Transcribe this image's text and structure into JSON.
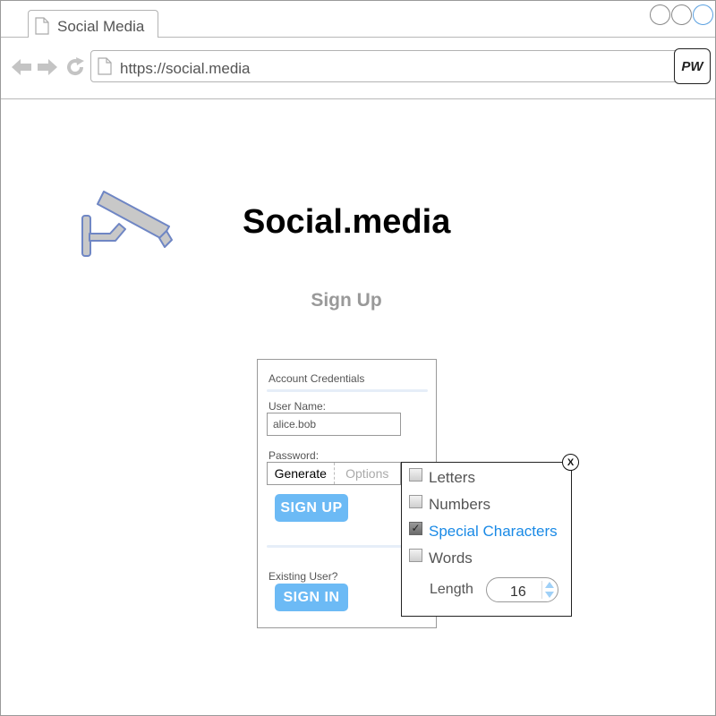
{
  "browser": {
    "tab_title": "Social Media",
    "url": "https://social.media",
    "extension_label": "PW",
    "icons": [
      "back-arrow-icon",
      "forward-arrow-icon",
      "reload-icon",
      "document-icon"
    ]
  },
  "page": {
    "site_title": "Social.media",
    "heading": "Sign Up",
    "logo_icon": "security-camera-icon"
  },
  "form": {
    "section_title": "Account Credentials",
    "username_label": "User Name:",
    "username_value": "alice.bob",
    "password_label": "Password:",
    "password_tabs": [
      "Generate",
      "Options"
    ],
    "active_password_tab": "Generate",
    "signup_button": "SIGN UP",
    "existing_user_label": "Existing User?",
    "signin_button": "SIGN IN"
  },
  "generator_popup": {
    "close_label": "X",
    "options": [
      {
        "label": "Letters",
        "checked": false
      },
      {
        "label": "Numbers",
        "checked": false
      },
      {
        "label": "Special Characters",
        "checked": true
      },
      {
        "label": "Words",
        "checked": false
      }
    ],
    "length_label": "Length",
    "length_value": "16"
  },
  "colors": {
    "button_blue": "#6cbaf5",
    "selected_text": "#1a8ae6",
    "camera_fill": "#c8c8c8",
    "camera_stroke": "#6f86c4"
  }
}
